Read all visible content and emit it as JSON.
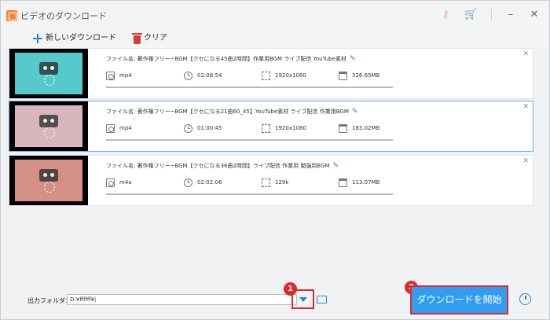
{
  "window": {
    "title": "ビデオのダウンロード",
    "controls": {
      "minimize": "–",
      "close": "✕"
    },
    "title_icons": [
      "key-icon",
      "cart-icon"
    ]
  },
  "toolbar": {
    "new_download_label": "新しいダウンロード",
    "clear_label": "クリア"
  },
  "colors": {
    "accent_blue": "#1e8be0",
    "start_button": "#2f9ef2",
    "highlight_red": "#e0282f",
    "thumb_1": "#55c9cc",
    "thumb_2": "#d9b6bd",
    "thumb_3": "#d48f86"
  },
  "items": [
    {
      "filename": "ファイル名: 著作権フリー~BGM【クセになる45曲2時間】作業用BGM ライブ配信 YouTube素材",
      "format": "mp4",
      "duration": "02:08:54",
      "resolution": "1920x1080",
      "size": "326.65MB"
    },
    {
      "filename": "ファイル名: 著作権フリー~BGM【クセになる21曲60_45】YouTube素材 ライブ配信 作業用BGM",
      "format": "mp4",
      "duration": "01:00:45",
      "resolution": "1920x1080",
      "size": "183.02MB"
    },
    {
      "filename": "ファイル名: 著作権フリー~BGM【クセになる36曲2時間】ライブ配信 作業用 勉強用BGM",
      "format": "m4a",
      "duration": "02:02:06",
      "resolution": "129k",
      "size": "113.07MB"
    }
  ],
  "bottom": {
    "output_folder_label": "出力フォルダ：",
    "output_folder_value": "D:¥ffffff¥j",
    "start_button_label": "ダウンロードを開始",
    "badge_1": "1",
    "badge_2": "2"
  }
}
